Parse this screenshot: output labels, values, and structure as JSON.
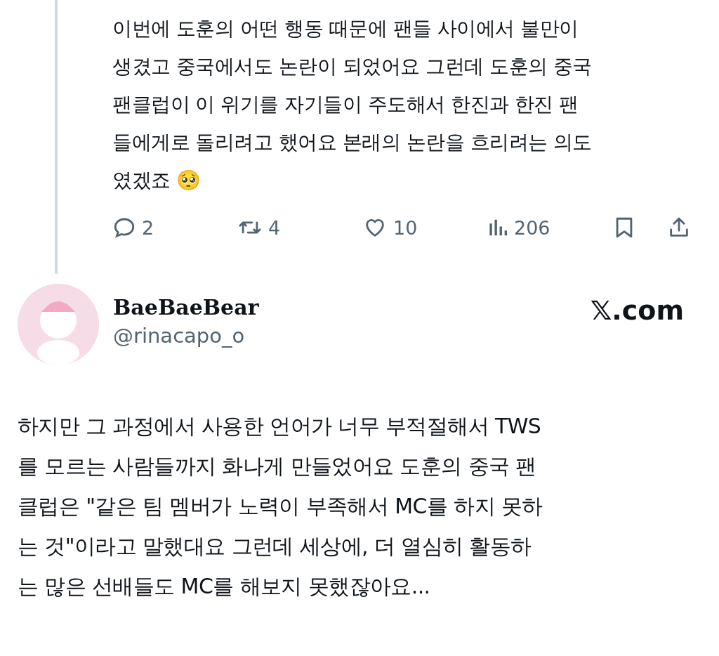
{
  "previous_tweet": {
    "text": "이번에 도훈의 어떤 행동 때문에 팬들 사이에서 불만이\n생겼고 중국에서도 논란이 되었어요 그런데 도훈의 중국\n팬클럽이 이 위기를 자기들이 주도해서 한진과 한진 팬\n들에게로 돌리려고 했어요 본래의 논란을 흐리려는 의도\n였겠죠 🥺",
    "actions": [
      {
        "kind": "reply",
        "count": "2"
      },
      {
        "kind": "repost",
        "count": "4"
      },
      {
        "kind": "like",
        "count": "10"
      },
      {
        "kind": "views",
        "count": "206"
      },
      {
        "kind": "bookmark"
      },
      {
        "kind": "share"
      }
    ]
  },
  "tweet": {
    "name": "BaeBaeBear",
    "handle": "@rinacapo_o",
    "site": "𝕏.com",
    "text": "하지만 그 과정에서 사용한 언어가 너무 부적절해서 TWS\n를 모르는 사람들까지 화나게 만들었어요 도훈의 중국 팬\n클럽은 \"같은 팀 멤버가 노력이 부족해서 MC를 하지 못하\n는 것\"이라고 말했대요 그런데 세상에, 더 열심히 활동하\n는 많은 선배들도 MC를 해보지 못했잖아요..."
  }
}
